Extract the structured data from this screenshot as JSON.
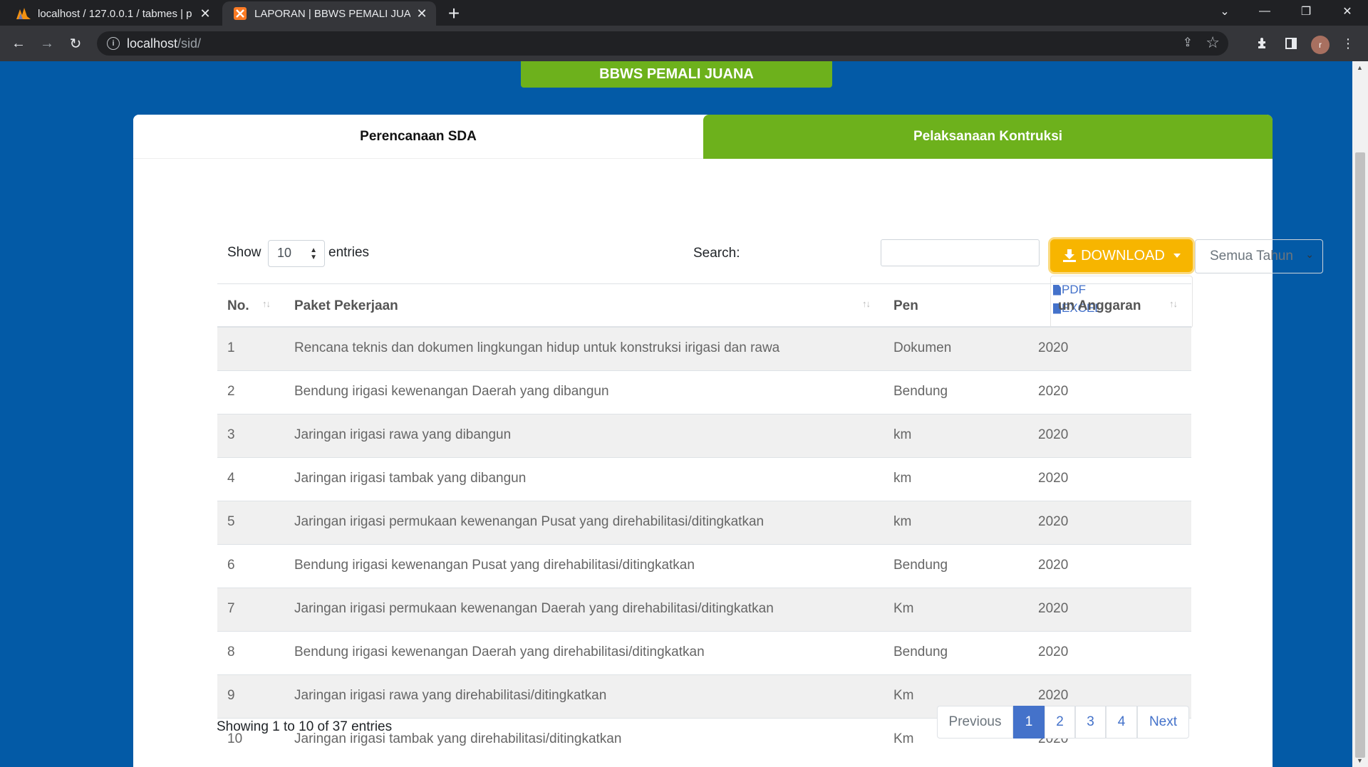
{
  "browser": {
    "tabs": [
      {
        "title": "localhost / 127.0.0.1 / tabmes | p"
      },
      {
        "title": "LAPORAN | BBWS PEMALI JUANA"
      }
    ],
    "url_host": "localhost",
    "url_path": "/sid/",
    "avatar_letter": "r"
  },
  "header": {
    "brand": "BBWS PEMALI JUANA"
  },
  "tabs": {
    "perencanaan": "Perencanaan SDA",
    "pelaksanaan": "Pelaksanaan Kontruksi"
  },
  "controls": {
    "show_label": "Show",
    "length_value": "10",
    "entries_label": "entries",
    "search_label": "Search:",
    "search_value": "",
    "download_label": "DOWNLOAD",
    "download_menu": [
      "PDF",
      "EXCEL"
    ],
    "year_select": "Semua Tahun"
  },
  "table": {
    "headers": [
      "No.",
      "Paket Pekerjaan",
      "Pen",
      "un Anggaran"
    ],
    "rows": [
      {
        "no": "1",
        "paket": "Rencana teknis dan dokumen lingkungan hidup untuk konstruksi irigasi dan rawa",
        "satuan": "Dokumen",
        "tahun": "2020"
      },
      {
        "no": "2",
        "paket": "Bendung irigasi kewenangan Daerah yang dibangun",
        "satuan": "Bendung",
        "tahun": "2020"
      },
      {
        "no": "3",
        "paket": "Jaringan irigasi rawa yang dibangun",
        "satuan": "km",
        "tahun": "2020"
      },
      {
        "no": "4",
        "paket": "Jaringan irigasi tambak yang dibangun",
        "satuan": "km",
        "tahun": "2020"
      },
      {
        "no": "5",
        "paket": "Jaringan irigasi permukaan kewenangan Pusat yang direhabilitasi/ditingkatkan",
        "satuan": "km",
        "tahun": "2020"
      },
      {
        "no": "6",
        "paket": "Bendung irigasi kewenangan Pusat yang direhabilitasi/ditingkatkan",
        "satuan": "Bendung",
        "tahun": "2020"
      },
      {
        "no": "7",
        "paket": "Jaringan irigasi permukaan kewenangan Daerah yang direhabilitasi/ditingkatkan",
        "satuan": "Km",
        "tahun": "2020"
      },
      {
        "no": "8",
        "paket": "Bendung irigasi kewenangan Daerah yang direhabilitasi/ditingkatkan",
        "satuan": "Bendung",
        "tahun": "2020"
      },
      {
        "no": "9",
        "paket": "Jaringan irigasi rawa yang direhabilitasi/ditingkatkan",
        "satuan": "Km",
        "tahun": "2020"
      },
      {
        "no": "10",
        "paket": "Jaringan irigasi tambak yang direhabilitasi/ditingkatkan",
        "satuan": "Km",
        "tahun": "2020"
      }
    ]
  },
  "footer": {
    "info": "Showing 1 to 10 of 37 entries",
    "pagination": [
      "Previous",
      "1",
      "2",
      "3",
      "4",
      "Next"
    ]
  },
  "colors": {
    "page_bg": "#035aa6",
    "accent_green": "#6db11c",
    "download": "#f7b500",
    "link": "#4472ca"
  },
  "icons": [
    "xampp-icon",
    "sid-icon",
    "back-icon",
    "forward-icon",
    "reload-icon",
    "info-icon",
    "share-icon",
    "star-icon",
    "extensions-icon",
    "sidepanel-icon",
    "menu-icon",
    "download-icon",
    "file-icon"
  ]
}
